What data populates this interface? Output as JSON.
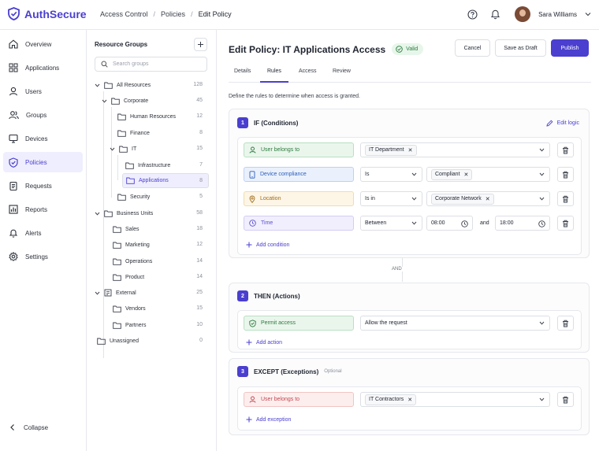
{
  "app": {
    "name": "AuthSecure"
  },
  "breadcrumb": [
    "Access Control",
    "Policies",
    "Edit Policy"
  ],
  "user": {
    "name": "Sara Williams"
  },
  "nav": {
    "items": [
      {
        "label": "Overview",
        "icon": "home-icon"
      },
      {
        "label": "Applications",
        "icon": "grid-icon"
      },
      {
        "label": "Users",
        "icon": "user-icon"
      },
      {
        "label": "Groups",
        "icon": "users-icon"
      },
      {
        "label": "Devices",
        "icon": "monitor-icon"
      },
      {
        "label": "Policies",
        "icon": "shield-icon",
        "active": true
      },
      {
        "label": "Requests",
        "icon": "clipboard-icon"
      },
      {
        "label": "Reports",
        "icon": "bar-chart-icon"
      },
      {
        "label": "Alerts",
        "icon": "bell-icon"
      },
      {
        "label": "Settings",
        "icon": "gear-icon"
      }
    ],
    "collapse_label": "Collapse"
  },
  "groups": {
    "title": "Resource Groups",
    "search_placeholder": "Search groups",
    "tree": [
      {
        "label": "All Resources",
        "count": "128"
      },
      {
        "label": "Corporate",
        "count": "45"
      },
      {
        "label": "Human Resources",
        "count": "12"
      },
      {
        "label": "Finance",
        "count": "8"
      },
      {
        "label": "IT",
        "count": "15"
      },
      {
        "label": "Infrastructure",
        "count": "7"
      },
      {
        "label": "Applications",
        "count": "8"
      },
      {
        "label": "Security",
        "count": "5"
      },
      {
        "label": "Business Units",
        "count": "58"
      },
      {
        "label": "Sales",
        "count": "18"
      },
      {
        "label": "Marketing",
        "count": "12"
      },
      {
        "label": "Operations",
        "count": "14"
      },
      {
        "label": "Product",
        "count": "14"
      },
      {
        "label": "External",
        "count": "25"
      },
      {
        "label": "Vendors",
        "count": "15"
      },
      {
        "label": "Partners",
        "count": "10"
      },
      {
        "label": "Unassigned",
        "count": "0"
      }
    ]
  },
  "page": {
    "title": "Edit Policy: IT Applications Access",
    "status": "Valid",
    "cancel_label": "Cancel",
    "draft_label": "Save as Draft",
    "publish_label": "Publish",
    "tabs": [
      "Details",
      "Rules",
      "Access",
      "Review"
    ],
    "description": "Define the rules to determine when access is granted."
  },
  "if_section": {
    "number": "1",
    "title": "IF (Conditions)",
    "edit_logic": "Edit logic",
    "conditions": [
      {
        "field": "User belongs to",
        "value_tag": "IT Department"
      },
      {
        "field": "Device compliance",
        "operator": "Is",
        "value_tag": "Compliant"
      },
      {
        "field": "Location",
        "operator": "Is in",
        "value_tag": "Corporate Network"
      },
      {
        "field": "Time",
        "operator": "Between",
        "start": "08:00",
        "and_label": "and",
        "end": "18:00"
      }
    ],
    "add_label": "Add condition"
  },
  "join_label": "AND",
  "then_section": {
    "number": "2",
    "title": "THEN (Actions)",
    "action": "Permit access",
    "value": "Allow the request",
    "add_label": "Add action"
  },
  "except_section": {
    "number": "3",
    "title": "EXCEPT (Exceptions)",
    "optional": "Optional",
    "field": "User belongs to",
    "value_tag": "IT Contractors",
    "add_label": "Add exception"
  },
  "colors": {
    "accent": "#4a3fcf",
    "valid": "#2b7a3e"
  }
}
